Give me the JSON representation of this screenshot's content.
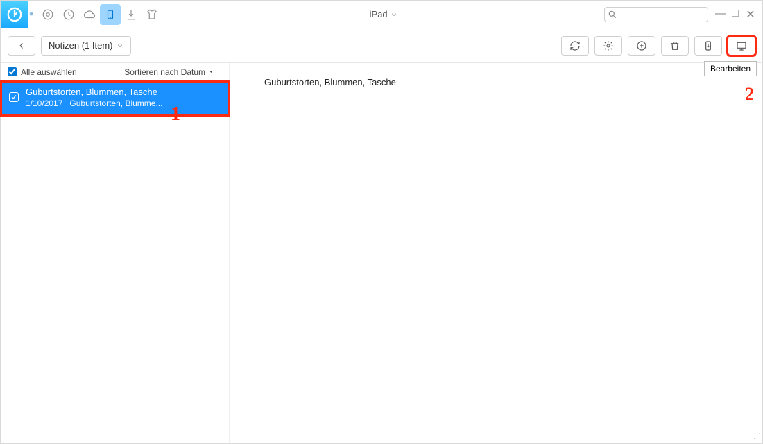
{
  "header": {
    "device": "iPad",
    "search_placeholder": ""
  },
  "subheader": {
    "breadcrumb": "Notizen (1 Item)",
    "tooltip": "Bearbeiten"
  },
  "filters": {
    "select_all": "Alle auswählen",
    "sort_label": "Sortieren nach Datum"
  },
  "notes": [
    {
      "title": "Guburtstorten, Blummen, Tasche",
      "date": "1/10/2017",
      "preview": "Guburtstorten, Blumme..."
    }
  ],
  "main": {
    "body": "Guburtstorten, Blummen, Tasche"
  },
  "callouts": {
    "one": "1",
    "two": "2"
  }
}
